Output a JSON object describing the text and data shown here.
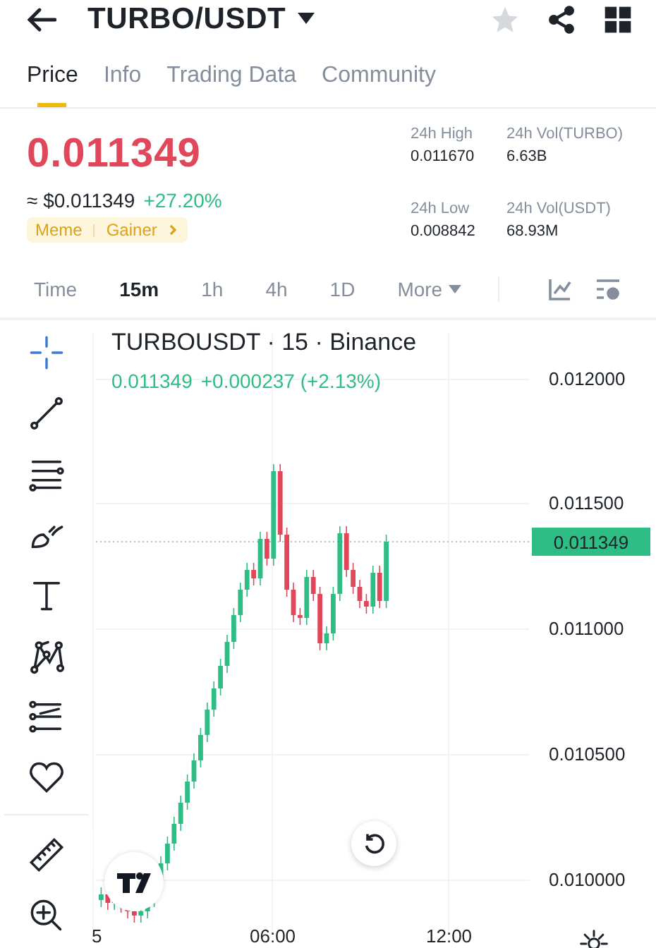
{
  "header": {
    "title": "TURBO/USDT",
    "favorite": false
  },
  "tabs": [
    {
      "label": "Price",
      "selected": true
    },
    {
      "label": "Info",
      "selected": false
    },
    {
      "label": "Trading Data",
      "selected": false
    },
    {
      "label": "Community",
      "selected": false
    }
  ],
  "price": {
    "last": "0.011349",
    "fiat": "≈ $0.011349",
    "change": "+27.20%",
    "tags": [
      "Meme",
      "Gainer"
    ]
  },
  "stats": [
    {
      "label": "24h High",
      "value": "0.011670"
    },
    {
      "label": "24h Vol(TURBO)",
      "value": "6.63B"
    },
    {
      "label": "24h Low",
      "value": "0.008842"
    },
    {
      "label": "24h Vol(USDT)",
      "value": "68.93M"
    }
  ],
  "intervals": [
    {
      "label": "Time",
      "selected": false
    },
    {
      "label": "15m",
      "selected": true
    },
    {
      "label": "1h",
      "selected": false
    },
    {
      "label": "4h",
      "selected": false
    },
    {
      "label": "1D",
      "selected": false
    },
    {
      "label": "More",
      "selected": false
    }
  ],
  "chart": {
    "title": "TURBOUSDT · 15 · Binance",
    "last": "0.011349",
    "change": "+0.000237 (+2.13%)",
    "y_labels": [
      "0.012000",
      "0.011500",
      "0.011000",
      "0.010500",
      "0.010000"
    ],
    "last_price_tag": "0.011349",
    "x_labels": [
      "5",
      "06:00",
      "12:00"
    ]
  }
}
